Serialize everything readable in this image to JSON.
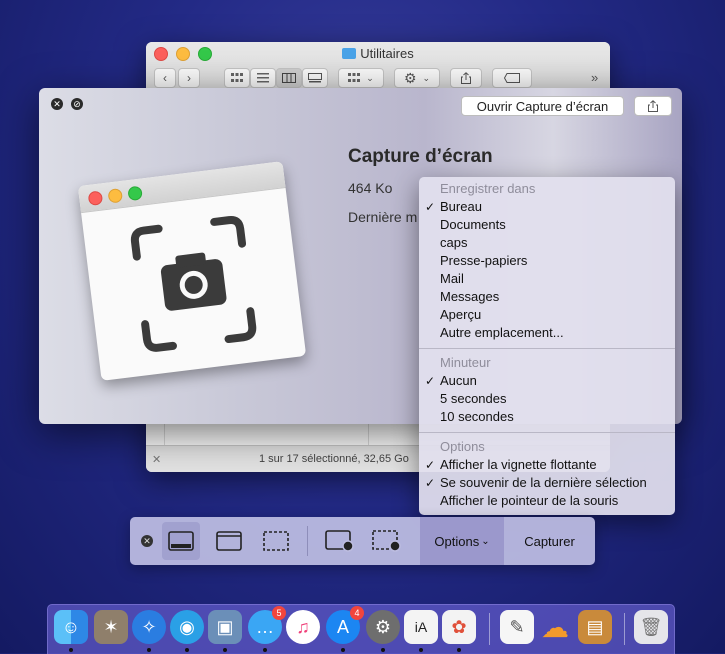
{
  "finder": {
    "title": "Utilitaires",
    "status": "1 sur 17 sélectionné, 32,65 Go"
  },
  "panel": {
    "open_button": "Ouvrir Capture d’écran",
    "app_name": "Capture d’écran",
    "size": "464 Ko",
    "modified_label": "Dernière m"
  },
  "menu": {
    "save_header": "Enregistrer dans",
    "save_items": [
      {
        "label": "Bureau",
        "checked": true
      },
      {
        "label": "Documents",
        "checked": false
      },
      {
        "label": "caps",
        "checked": false
      },
      {
        "label": "Presse-papiers",
        "checked": false
      },
      {
        "label": "Mail",
        "checked": false
      },
      {
        "label": "Messages",
        "checked": false
      },
      {
        "label": "Aperçu",
        "checked": false
      },
      {
        "label": "Autre emplacement...",
        "checked": false
      }
    ],
    "timer_header": "Minuteur",
    "timer_items": [
      {
        "label": "Aucun",
        "checked": true
      },
      {
        "label": "5 secondes",
        "checked": false
      },
      {
        "label": "10 secondes",
        "checked": false
      }
    ],
    "options_header": "Options",
    "options_items": [
      {
        "label": "Afficher la vignette flottante",
        "checked": true
      },
      {
        "label": "Se souvenir de la dernière sélection",
        "checked": true
      },
      {
        "label": "Afficher le pointeur de la souris",
        "checked": false
      }
    ]
  },
  "capture_bar": {
    "options_label": "Options",
    "capture_label": "Capturer"
  },
  "dock": {
    "messages_badge": "5",
    "appstore_badge": "4"
  }
}
